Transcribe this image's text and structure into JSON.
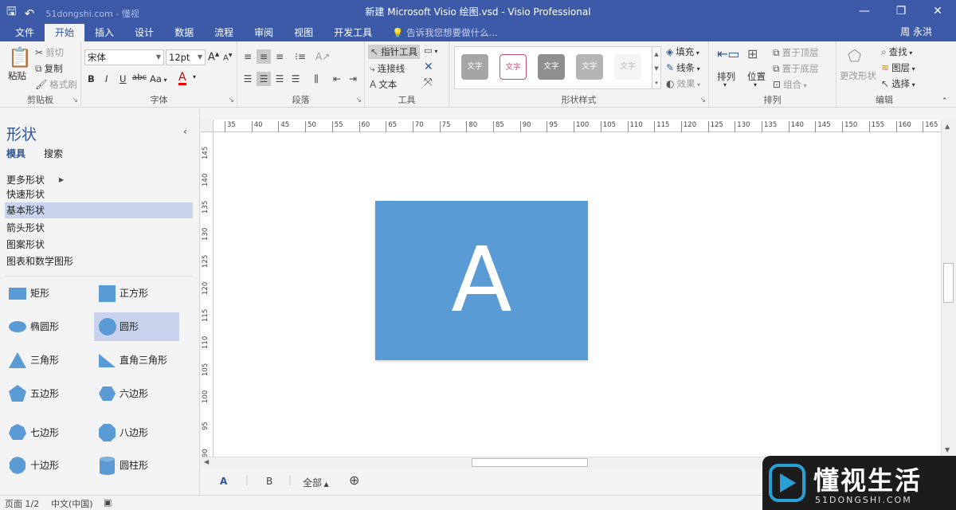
{
  "titlebar": {
    "title": "新建 Microsoft Visio 绘图.vsd - Visio Professional",
    "watermark": "51dongshi.com - 懂视",
    "minimize": "—",
    "restore": "❐",
    "close": "✕"
  },
  "tabs": {
    "items": [
      "文件",
      "开始",
      "插入",
      "设计",
      "数据",
      "流程",
      "审阅",
      "视图",
      "开发工具"
    ],
    "active": "开始",
    "tellme": "告诉我您想要做什么...",
    "user": "周 永洪"
  },
  "ribbon": {
    "clipboard": {
      "label": "剪贴板",
      "paste": "粘贴",
      "cut": "剪切",
      "copy": "复制",
      "format_painter": "格式刷"
    },
    "font": {
      "label": "字体",
      "font_name": "宋体",
      "font_size": "12pt",
      "bold": "B",
      "italic": "I",
      "underline": "U",
      "strike": "abc",
      "case": "Aa",
      "color": "A",
      "grow": "A",
      "shrink": "A"
    },
    "paragraph": {
      "label": "段落"
    },
    "tools": {
      "label": "工具",
      "pointer": "指针工具",
      "connector": "连接线",
      "text": "文本"
    },
    "shape_styles": {
      "label": "形状样式",
      "sample": "文字",
      "fill": "填充",
      "line": "线条",
      "effects": "效果"
    },
    "arrange": {
      "label": "排列",
      "arrange": "排列",
      "position": "位置",
      "bring_front": "置于顶层",
      "send_back": "置于底层",
      "group": "组合"
    },
    "editing": {
      "label": "编辑",
      "change_shape": "更改形状",
      "find": "查找",
      "layers": "图层",
      "select": "选择"
    }
  },
  "panel": {
    "title": "形状",
    "tab_stencils": "模具",
    "tab_search": "搜索",
    "stencils": [
      "更多形状",
      "快速形状",
      "基本形状",
      "箭头形状",
      "图案形状",
      "图表和数学图形"
    ],
    "selected_stencil": "基本形状",
    "shapes": [
      {
        "label": "矩形",
        "icon": "rectangle-icon"
      },
      {
        "label": "正方形",
        "icon": "square-icon"
      },
      {
        "label": "椭圆形",
        "icon": "ellipse-icon"
      },
      {
        "label": "圆形",
        "icon": "circle-icon"
      },
      {
        "label": "三角形",
        "icon": "triangle-icon"
      },
      {
        "label": "直角三角形",
        "icon": "right-triangle-icon"
      },
      {
        "label": "五边形",
        "icon": "pentagon-icon"
      },
      {
        "label": "六边形",
        "icon": "hexagon-icon"
      },
      {
        "label": "七边形",
        "icon": "heptagon-icon"
      },
      {
        "label": "八边形",
        "icon": "octagon-icon"
      },
      {
        "label": "十边形",
        "icon": "decagon-icon"
      },
      {
        "label": "圆柱形",
        "icon": "cylinder-icon"
      }
    ],
    "selected_shape": "圆形",
    "accent": "#5b9bd5"
  },
  "canvas": {
    "shape_text": "A",
    "shape_fill": "#5b9bd5",
    "hruler": [
      "35",
      "40",
      "45",
      "50",
      "55",
      "60",
      "65",
      "70",
      "75",
      "80",
      "85",
      "90",
      "95",
      "100",
      "105",
      "110",
      "115",
      "120",
      "125",
      "130",
      "135",
      "140",
      "145",
      "150",
      "155",
      "160",
      "165"
    ],
    "vruler": [
      "145",
      "140",
      "135",
      "130",
      "125",
      "120",
      "115",
      "110",
      "105",
      "100",
      "95",
      "90"
    ]
  },
  "pages": {
    "tabs": [
      "A",
      "B"
    ],
    "active": "A",
    "all": "全部"
  },
  "status": {
    "page": "页面 1/2",
    "language": "中文(中国)"
  },
  "logo": {
    "big": "懂视生活",
    "small": "51DONGSHI.COM"
  }
}
